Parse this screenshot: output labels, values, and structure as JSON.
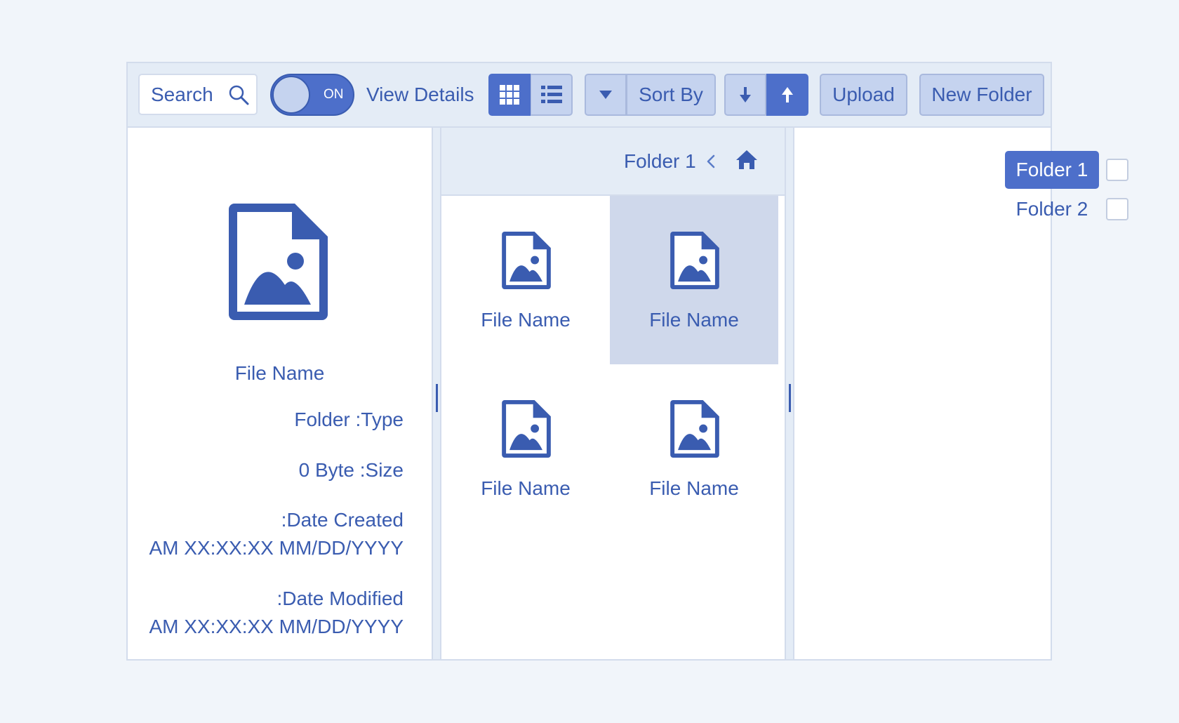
{
  "toolbar": {
    "search": {
      "placeholder": "Search"
    },
    "view_details_toggle": {
      "state_label": "ON",
      "is_on": true
    },
    "view_details_label": "View Details",
    "view_mode": {
      "options": [
        "grid",
        "list"
      ],
      "selected": "grid"
    },
    "sort_label": "Sort By",
    "sort_order": {
      "options": [
        "descending",
        "ascending"
      ],
      "selected": "ascending"
    },
    "upload_label": "Upload",
    "new_folder_label": "New Folder"
  },
  "details": {
    "file_name": "File Name",
    "type_line": "Folder :Type",
    "size_line": "0 Byte :Size",
    "date_created_label": ":Date Created",
    "date_created_value": "AM XX:XX:XX MM/DD/YYYY",
    "date_modified_label": ":Date Modified",
    "date_modified_value": "AM XX:XX:XX MM/DD/YYYY"
  },
  "breadcrumb": {
    "current": "Folder 1"
  },
  "files": [
    {
      "name": "File Name",
      "selected": false
    },
    {
      "name": "File Name",
      "selected": true
    },
    {
      "name": "File Name",
      "selected": false
    },
    {
      "name": "File Name",
      "selected": false
    }
  ],
  "folders": [
    {
      "name": "Folder 1",
      "active": true,
      "checked": false
    },
    {
      "name": "Folder 2",
      "active": false,
      "checked": false
    }
  ],
  "colors": {
    "accent": "#4d6fca",
    "text": "#3a5cb0",
    "toolbar_bg": "#e4ecf6",
    "button_bg": "#c5d3ef",
    "selected_tile_bg": "#cfd8eb",
    "page_bg": "#f1f5fa"
  }
}
